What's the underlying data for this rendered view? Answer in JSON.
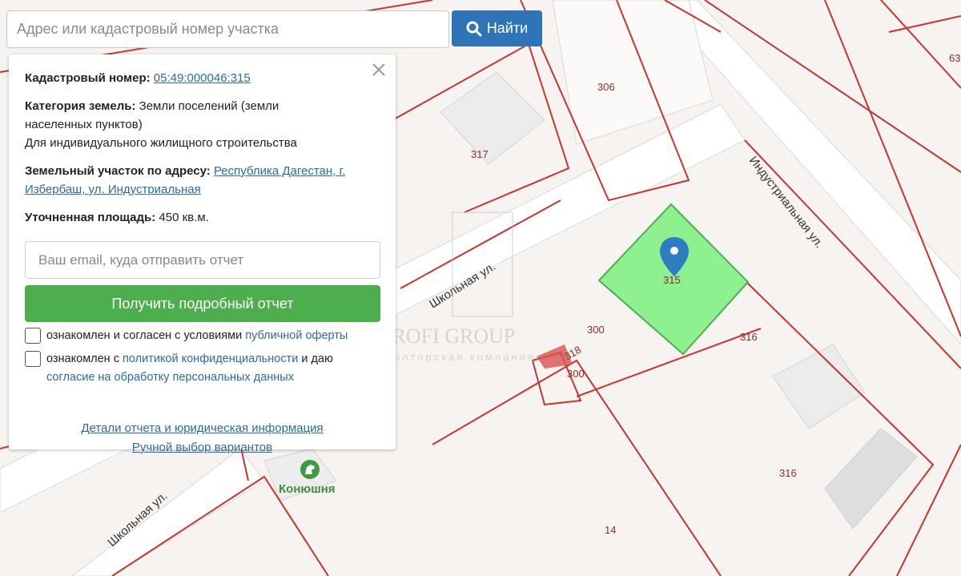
{
  "search": {
    "placeholder": "Адрес или кадастровый номер участка",
    "button_label": "Найти"
  },
  "panel": {
    "cadastral_label": "Кадастровый номер:",
    "cadastral_number": "05:49:000046:315",
    "category_label": "Категория земель:",
    "category_value_1": "Земли поселений (земли",
    "category_value_2": "населенных пунктов)",
    "usage": "Для индивидуального жилищного строительства",
    "address_label": "Земельный участок по адресу:",
    "address_link_1": "Республика Дагестан, г.",
    "address_link_2": "Избербаш, ул. Индустриальная",
    "area_label": "Уточненная площадь:",
    "area_value": "450 кв.м.",
    "email_placeholder": "Ваш email, куда отправить отчет",
    "report_button": "Получить подробный отчет",
    "consent1_text": "ознакомлен и согласен с условиями",
    "consent1_link": "публичной оферты",
    "consent2_text_a": "ознакомлен с",
    "consent2_link_a": "политикой конфиденциальности",
    "consent2_text_b": "и даю",
    "consent2_link_b": "согласие на обработку персональных данных",
    "footer_link_1": "Детали отчета и юридическая информация",
    "footer_link_2": "Ручной выбор вариантов"
  },
  "map": {
    "parcel_labels": [
      "306",
      "317",
      "315",
      "300",
      "318",
      "300",
      "316",
      "316",
      "14",
      "63"
    ],
    "streets": [
      "Школьная ул.",
      "Индустриальная ул.",
      "Школьная ул."
    ],
    "poi": "Конюшня",
    "watermark_title": "PROFI GROUP",
    "watermark_sub": "риэлторская компания",
    "selected_color": "#8ef08e",
    "boundary_color": "#c9342b"
  }
}
